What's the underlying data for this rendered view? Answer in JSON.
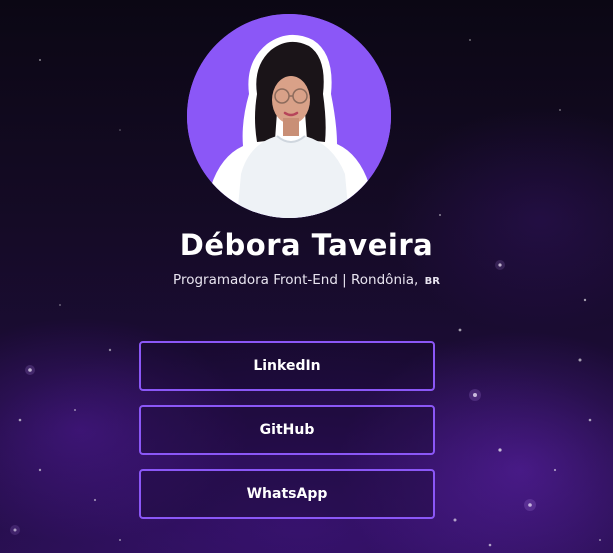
{
  "profile": {
    "name": "Débora Taveira",
    "role": "Programadora Front-End | Rondônia,",
    "country": "BR"
  },
  "links": [
    {
      "label": "LinkedIn"
    },
    {
      "label": "GitHub"
    },
    {
      "label": "WhatsApp"
    }
  ],
  "colors": {
    "accent": "#8b57f7",
    "background_top": "#0b0714",
    "background_bottom": "#260f4c",
    "text": "#ffffff"
  }
}
